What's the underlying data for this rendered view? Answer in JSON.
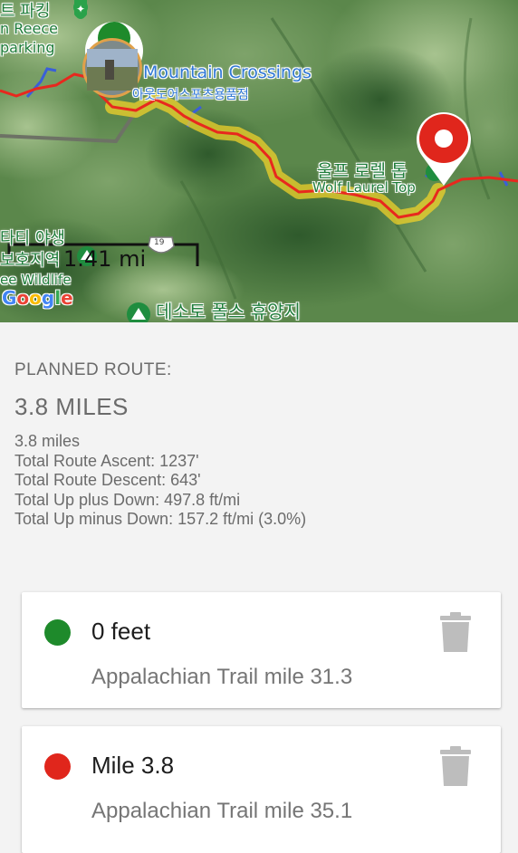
{
  "map": {
    "labels": {
      "hiking_kr": "트 파킹",
      "reece": "n Reece",
      "parking": "parking",
      "mountain_crossings": "Mountain Crossings",
      "mountain_crossings_kr": "아웃도어스포츠용품점",
      "wolf_laurel_kr": "울프 로렐 톱",
      "wolf_laurel": "Wolf Laurel Top",
      "wildlife_kr1": "타티 야생",
      "wildlife_kr2": "보호지역",
      "wildlife": "ee Wildlife",
      "desoto_kr": "데소토 폴스 휴양지",
      "route_badge": "19"
    },
    "scale": "1.41 mi",
    "attribution": "Google",
    "colors": {
      "route": "#e8281e",
      "route_highlight": "#f0d22a",
      "start": "#1e8a2b",
      "end": "#e0261c"
    }
  },
  "route": {
    "heading": "PLANNED ROUTE:",
    "distance_headline": "3.8 MILES",
    "stats": [
      "3.8 miles",
      "Total Route Ascent: 1237'",
      "Total Route Descent: 643'",
      "Total Up plus Down: 497.8 ft/mi",
      "Total Up minus Down: 157.2 ft/mi (3.0%)"
    ]
  },
  "waypoints": [
    {
      "title": "0 feet",
      "subtitle": "Appalachian Trail mile 31.3",
      "color": "#1e8a2b",
      "icon": "trash-icon"
    },
    {
      "title": "Mile 3.8",
      "subtitle": "Appalachian Trail mile 35.1",
      "color": "#e0261c",
      "icon": "trash-icon"
    }
  ]
}
